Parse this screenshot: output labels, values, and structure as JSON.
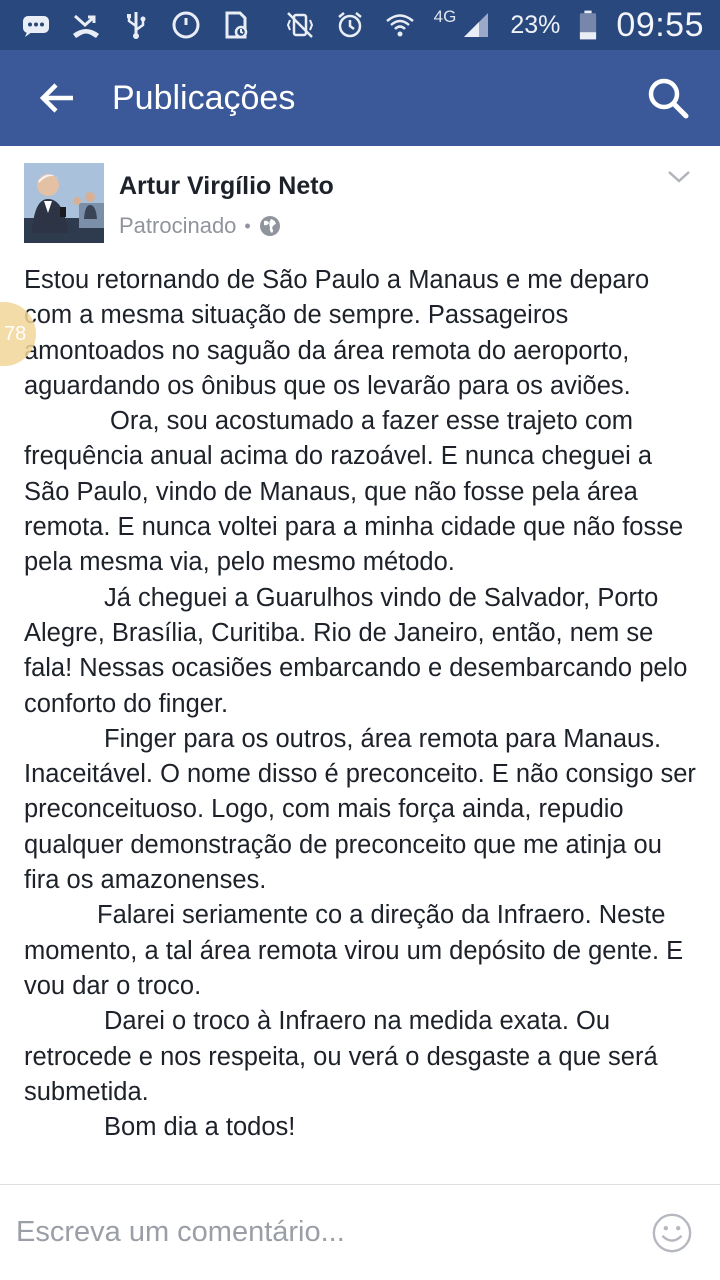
{
  "status_bar": {
    "network_type": "4G",
    "battery_percent": "23%",
    "time": "09:55",
    "icons": [
      "chat-icon",
      "missed-call-icon",
      "usb-icon",
      "sync-icon",
      "sim-card-icon",
      "vibrate-icon",
      "alarm-icon",
      "wifi-icon",
      "signal-icon",
      "battery-icon"
    ]
  },
  "app_bar": {
    "title": "Publicações",
    "back_icon": "arrow-left-icon",
    "search_icon": "search-icon",
    "bg_color": "#3b5998"
  },
  "post": {
    "author": "Artur Virgílio Neto",
    "sponsored_label": "Patrocinado",
    "separator": "•",
    "paragraphs": [
      "Estou retornando de São Paulo a Manaus e me deparo com a mesma situação de sempre. Passageiros amontoados no saguão da área remota do aeroporto, aguardando os ônibus que os levarão para os aviões.",
      "Ora, sou acostumado a fazer esse trajeto com frequência anual acima do razoável. E nunca cheguei a São Paulo, vindo de Manaus, que não fosse pela área remota. E nunca voltei para a minha cidade que não fosse pela mesma via, pelo mesmo método.",
      "Já cheguei a Guarulhos vindo de Salvador, Porto Alegre, Brasília, Curitiba. Rio de Janeiro, então, nem se fala! Nessas ocasiões embarcando e desembarcando pelo conforto do finger.",
      "Finger para os outros, área remota para Manaus. Inaceitável. O nome disso é preconceito. E não consigo ser preconceituoso. Logo, com mais força ainda, repudio qualquer demonstração de preconceito que me atinja ou fira os amazonenses.",
      "Falarei seriamente co a direção da Infraero. Neste momento, a tal área remota virou um depósito de gente. E vou dar o troco.",
      "Darei o troco à Infraero na medida exata. Ou retrocede e nos respeita, ou verá o desgaste a que será submetida.",
      "Bom dia a todos!"
    ]
  },
  "side_badge": {
    "text": "78"
  },
  "comment_bar": {
    "placeholder": "Escreva um comentário...",
    "emoji_icon": "smiley-icon"
  }
}
